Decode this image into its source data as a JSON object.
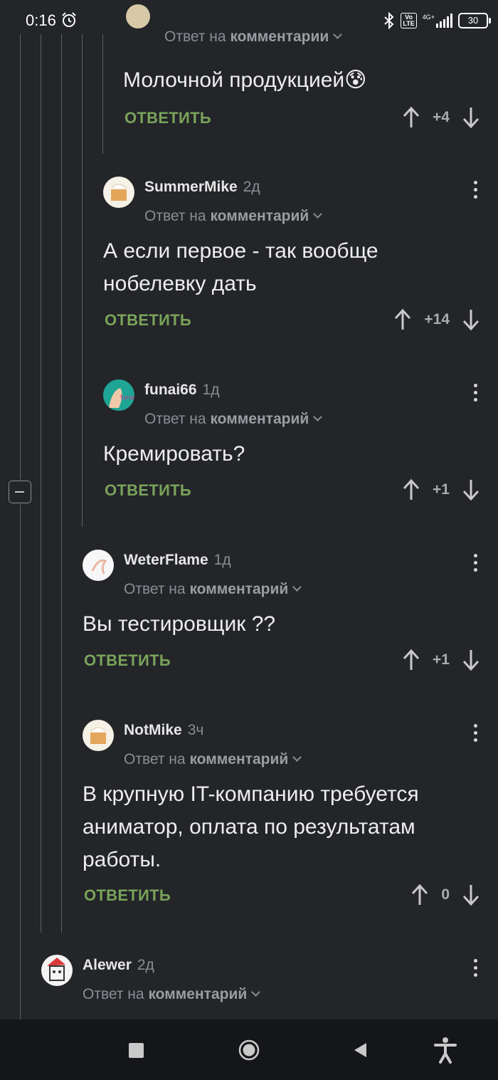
{
  "status_bar": {
    "time": "0:16",
    "network": "4G+",
    "volte": "Vo LTE",
    "battery": "30"
  },
  "ui": {
    "reply_prefix": "Ответ на",
    "reply_target": "комментарий",
    "reply_target_top": "комментарии",
    "reply_button": "ОТВЕТИТЬ"
  },
  "comments": [
    {
      "username": "",
      "time": "",
      "text_lines": [
        "Молочной продукцией😰"
      ],
      "score": "+4"
    },
    {
      "username": "SummerMike",
      "time": "2д",
      "text_lines": [
        "А если первое - так вообще",
        "нобелевку дать"
      ],
      "score": "+14"
    },
    {
      "username": "funai66",
      "time": "1д",
      "text_lines": [
        "Кремировать?"
      ],
      "score": "+1"
    },
    {
      "username": "WeterFlame",
      "time": "1д",
      "text_lines": [
        "Вы тестировщик ??"
      ],
      "score": "+1"
    },
    {
      "username": "NotMike",
      "time": "3ч",
      "text_lines": [
        "В крупную IT-компанию требуется",
        "аниматор, оплата по результатам",
        "работы."
      ],
      "score": "0"
    },
    {
      "username": "Alewer",
      "time": "2д",
      "text_lines": [],
      "score": ""
    }
  ],
  "colors": {
    "background": "#232529",
    "reply_green": "#7aa35a",
    "muted": "#8a8d93",
    "navbar": "#15161a"
  }
}
